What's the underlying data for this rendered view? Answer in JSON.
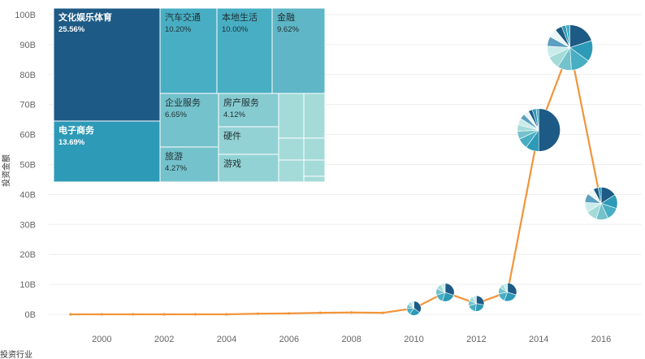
{
  "colors": {
    "line": "#f2943a",
    "grid": "#eeeeee",
    "pie_palette": [
      "#1d5a85",
      "#2d9ab7",
      "#48aec3",
      "#74c2cb",
      "#a4dbd9",
      "#c9ecea",
      "#5c9fc0",
      "#e9f6f5"
    ]
  },
  "chart_data": [
    {
      "type": "line",
      "title": "",
      "xlabel": "",
      "ylabel": "投资金额",
      "x_ticks": [
        "2000",
        "2002",
        "2004",
        "2006",
        "2008",
        "2010",
        "2012",
        "2014",
        "2016"
      ],
      "y_ticks": [
        "0B",
        "10B",
        "20B",
        "30B",
        "40B",
        "50B",
        "60B",
        "70B",
        "80B",
        "90B",
        "100B"
      ],
      "xlim": [
        1998.3,
        2017.3
      ],
      "ylim": [
        0,
        100
      ],
      "grid": true,
      "series": [
        {
          "x": [
            1999,
            2000,
            2001,
            2002,
            2003,
            2004,
            2005,
            2006,
            2007,
            2008,
            2009,
            2010,
            2011,
            2012,
            2013,
            2014,
            2015,
            2016
          ],
          "values": [
            0.0,
            0.0,
            0.0,
            0.0,
            0.0,
            0.0,
            0.2,
            0.3,
            0.5,
            0.6,
            0.5,
            2.0,
            7.3,
            3.6,
            7.4,
            61.5,
            89.0,
            37.0
          ]
        }
      ],
      "pie_markers": [
        {
          "x": 2010,
          "value": 2.0,
          "size": 0.3,
          "slices": [
            35,
            25,
            15,
            10,
            8,
            7
          ]
        },
        {
          "x": 2011,
          "value": 7.3,
          "size": 0.45,
          "slices": [
            30,
            25,
            15,
            12,
            10,
            8
          ]
        },
        {
          "x": 2012,
          "value": 3.6,
          "size": 0.35,
          "slices": [
            28,
            24,
            18,
            12,
            10,
            8
          ]
        },
        {
          "x": 2013,
          "value": 7.4,
          "size": 0.45,
          "slices": [
            30,
            26,
            16,
            12,
            8,
            8
          ]
        },
        {
          "x": 2014,
          "value": 61.5,
          "size": 1.4,
          "slices": [
            50,
            10,
            8,
            6,
            5,
            5,
            4,
            4,
            3,
            3,
            2
          ]
        },
        {
          "x": 2015,
          "value": 89.0,
          "size": 1.5,
          "slices": [
            20,
            15,
            14,
            10,
            9,
            8,
            7,
            6,
            5,
            3,
            3
          ]
        },
        {
          "x": 2016,
          "value": 37.0,
          "size": 1.0,
          "slices": [
            16,
            14,
            13,
            12,
            11,
            10,
            9,
            7,
            5,
            3
          ]
        }
      ]
    },
    {
      "type": "treemap",
      "items": [
        {
          "name": "文化娱乐体育",
          "pct": "25.56%"
        },
        {
          "name": "电子商务",
          "pct": "13.69%"
        },
        {
          "name": "汽车交通",
          "pct": "10.20%"
        },
        {
          "name": "本地生活",
          "pct": "10.00%"
        },
        {
          "name": "金融",
          "pct": "9.62%"
        },
        {
          "name": "企业服务",
          "pct": "6.65%"
        },
        {
          "name": "房产服务",
          "pct": "4.12%"
        },
        {
          "name": "旅游",
          "pct": "4.27%"
        },
        {
          "name": "硬件",
          "pct": ""
        },
        {
          "name": "游戏",
          "pct": ""
        }
      ]
    }
  ],
  "footer": {
    "label": "投资行业"
  }
}
